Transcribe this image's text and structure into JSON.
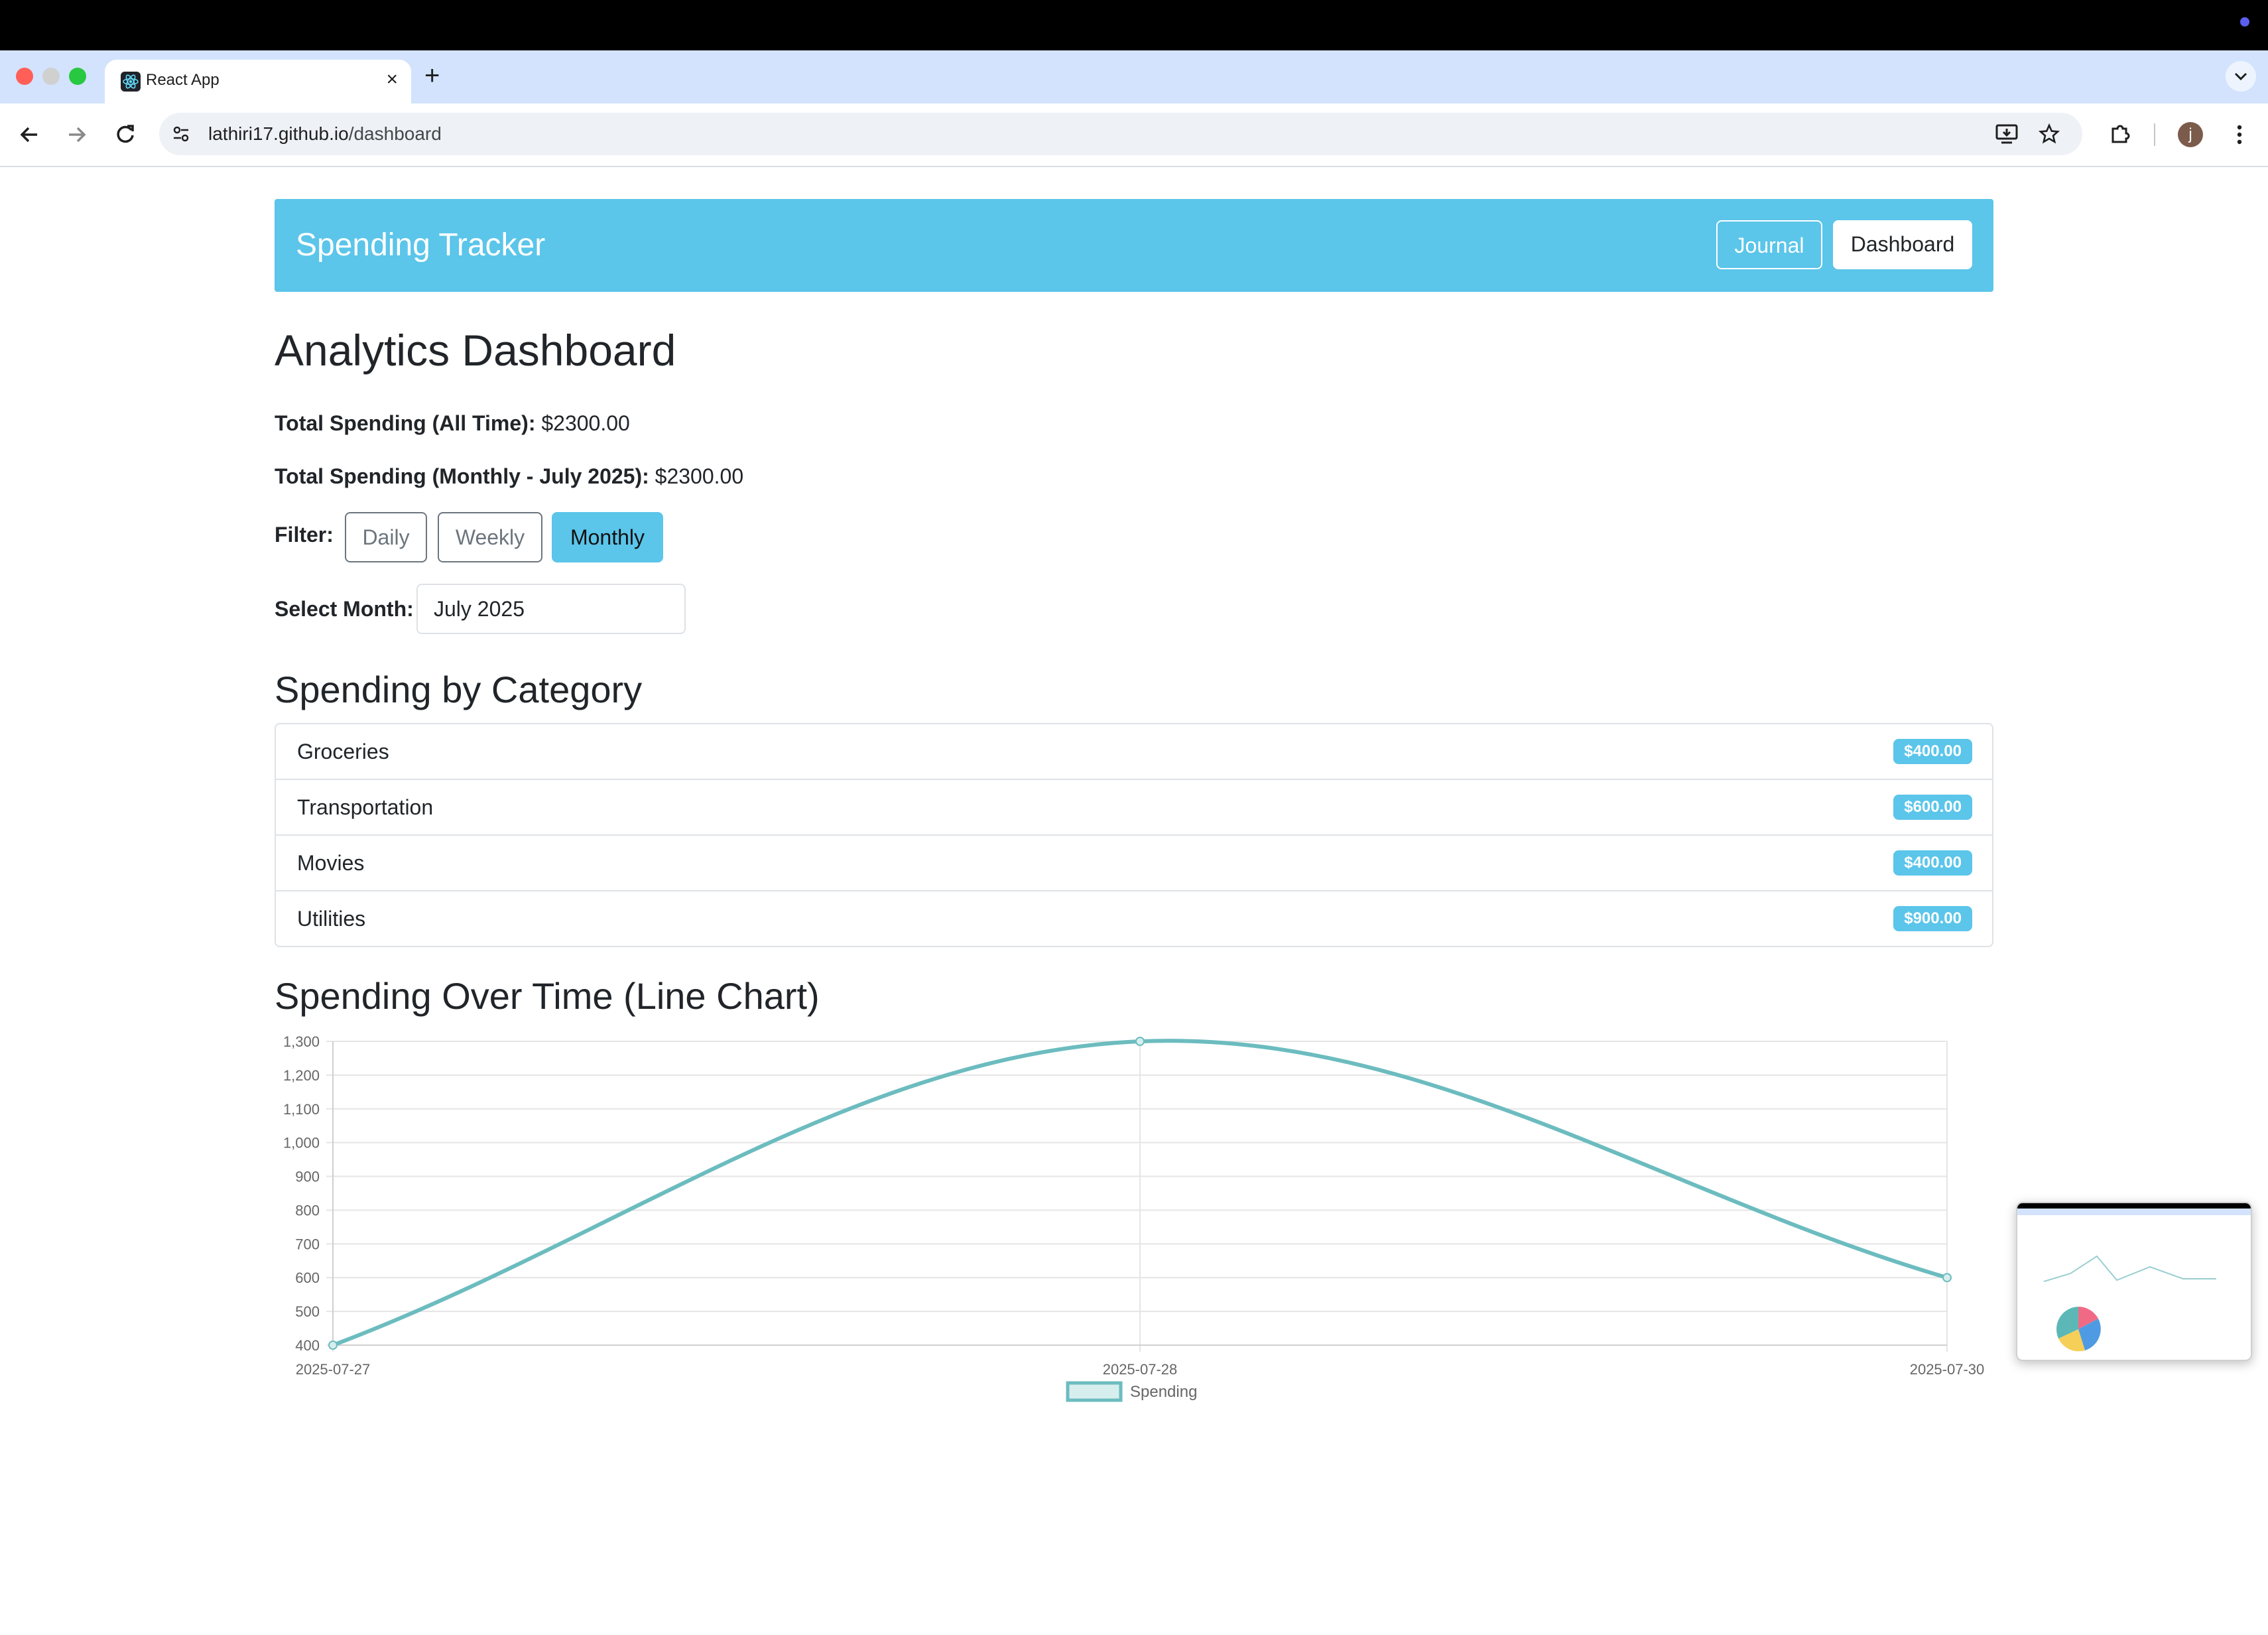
{
  "browser": {
    "tab_title": "React App",
    "url_host": "lathiri17.github.io",
    "url_path": "/dashboard",
    "profile_initial": "j"
  },
  "app": {
    "brand": "Spending Tracker",
    "nav": {
      "journal": "Journal",
      "dashboard": "Dashboard"
    }
  },
  "dashboard": {
    "title": "Analytics Dashboard",
    "total_all_label": "Total Spending (All Time):",
    "total_all_value": "$2300.00",
    "total_month_label": "Total Spending (Monthly - July 2025):",
    "total_month_value": "$2300.00",
    "filter_label": "Filter:",
    "filters": [
      "Daily",
      "Weekly",
      "Monthly"
    ],
    "active_filter": "Monthly",
    "month_label": "Select Month:",
    "month_value": "July 2025",
    "category_heading": "Spending by Category",
    "categories": [
      {
        "name": "Groceries",
        "amount": "$400.00"
      },
      {
        "name": "Transportation",
        "amount": "$600.00"
      },
      {
        "name": "Movies",
        "amount": "$400.00"
      },
      {
        "name": "Utilities",
        "amount": "$900.00"
      }
    ],
    "chart_heading": "Spending Over Time (Line Chart)"
  },
  "colors": {
    "accent": "#5bc5ea",
    "line": "#6cbcbf"
  },
  "chart_data": {
    "type": "line",
    "x": [
      "2025-07-27",
      "2025-07-28",
      "2025-07-30"
    ],
    "series": [
      {
        "name": "Spending",
        "values": [
          400,
          1300,
          600
        ]
      }
    ],
    "ylim": [
      400,
      1300
    ],
    "yticks": [
      "400",
      "500",
      "600",
      "700",
      "800",
      "900",
      "1,000",
      "1,100",
      "1,200",
      "1,300"
    ],
    "legend": "bottom",
    "grid": true
  }
}
